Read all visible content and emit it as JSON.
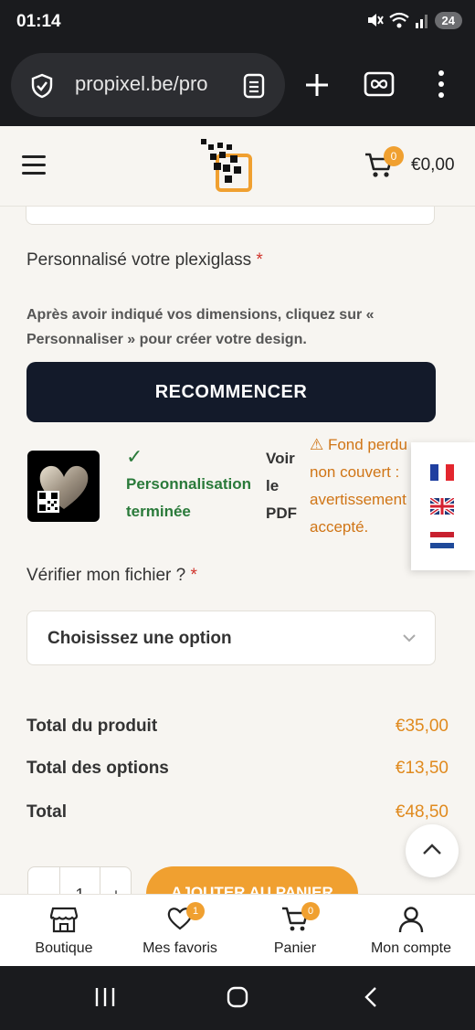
{
  "status_bar": {
    "time": "01:14",
    "battery": "24"
  },
  "browser": {
    "url": "propixel.be/pro"
  },
  "header": {
    "cart_count": "0",
    "cart_total": "€0,00"
  },
  "personalize": {
    "label": "Personnalisé votre plexiglass",
    "required_mark": "*",
    "help_text": "Après avoir indiqué vos dimensions, cliquez sur « Personnaliser » pour créer votre design.",
    "restart_label": "RECOMMENCER",
    "done_check": "✓",
    "done_line1": "Personnalisation",
    "done_line2": "terminée",
    "view_pdf_line1": "Voir",
    "view_pdf_line2": "le",
    "view_pdf_line3": "PDF",
    "warning_line1": "⚠ Fond perdu",
    "warning_line2": "non couvert :",
    "warning_line3": "avertissement",
    "warning_line4": "accepté."
  },
  "verify": {
    "label": "Vérifier mon fichier ?",
    "required_mark": "*",
    "selected": "Choisissez une option"
  },
  "totals": [
    {
      "label": "Total du produit",
      "amount": "€35,00"
    },
    {
      "label": "Total des options",
      "amount": "€13,50"
    },
    {
      "label": "Total",
      "amount": "€48,50"
    }
  ],
  "purchase": {
    "quantity": "1",
    "minus": "-",
    "plus": "+",
    "add_to_cart": "AJOUTER AU PANIER"
  },
  "languages": [
    "fr",
    "en",
    "nl"
  ],
  "tabbar": [
    {
      "label": "Boutique",
      "icon": "store-icon"
    },
    {
      "label": "Mes favoris",
      "icon": "heart-icon",
      "badge": "1"
    },
    {
      "label": "Panier",
      "icon": "cart-icon",
      "badge": "0"
    },
    {
      "label": "Mon compte",
      "icon": "user-icon"
    }
  ],
  "colors": {
    "accent": "#f0a030",
    "dark_button": "#131a2a",
    "success": "#2a7a3a",
    "warning": "#d07516",
    "price": "#e08a1e"
  }
}
